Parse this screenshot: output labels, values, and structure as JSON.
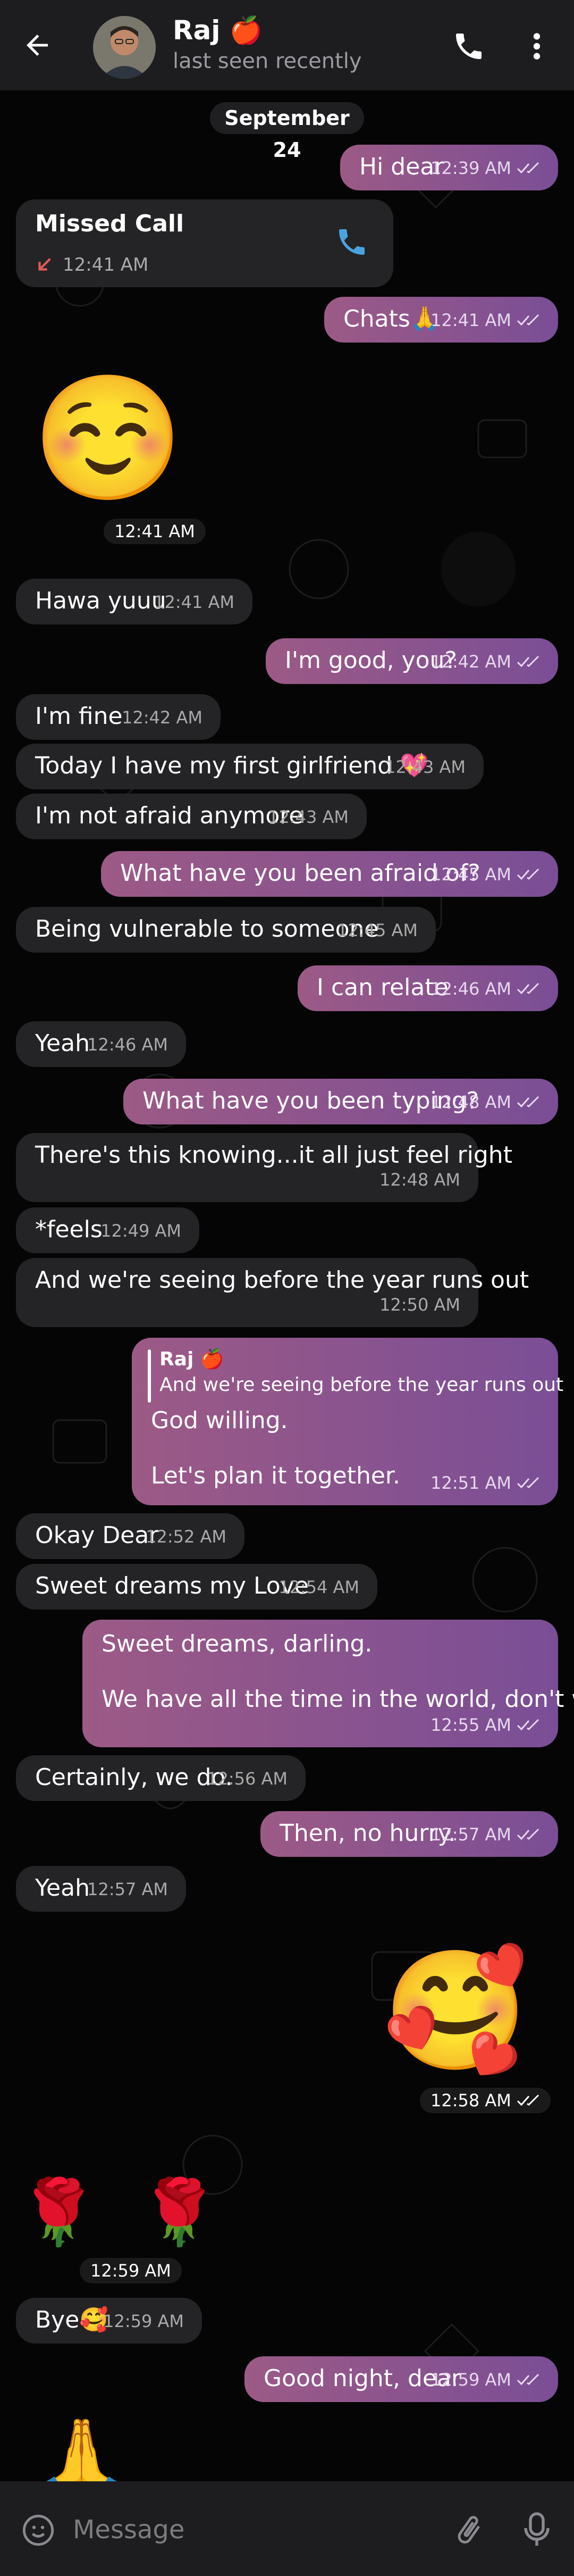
{
  "header": {
    "contact_name": "Raj 🍎",
    "status": "last seen recently"
  },
  "chat": {
    "date_label": "September 24",
    "messages": [
      {
        "dir": "out",
        "text": "Hi dear",
        "time": "12:39 AM"
      },
      {
        "dir": "in",
        "type": "call",
        "text": "Missed Call",
        "time": "12:41 AM"
      },
      {
        "dir": "out",
        "text": "Chats🙏",
        "time": "12:41 AM"
      },
      {
        "dir": "in",
        "type": "emoji",
        "text": "☺️",
        "time": "12:41 AM"
      },
      {
        "dir": "in",
        "text": "Hawa yuuu",
        "time": "12:41 AM"
      },
      {
        "dir": "out",
        "text": "I'm good, you?",
        "time": "12:42 AM"
      },
      {
        "dir": "in",
        "text": "I'm fine",
        "time": "12:42 AM"
      },
      {
        "dir": "in",
        "text": "Today I have my first girlfriend 💖",
        "time": "12:43 AM"
      },
      {
        "dir": "in",
        "text": "I'm not afraid anymore",
        "time": "12:43 AM"
      },
      {
        "dir": "out",
        "text": "What have you been afraid of?",
        "time": "12:45 AM"
      },
      {
        "dir": "in",
        "text": "Being vulnerable to someone",
        "time": "12:45 AM"
      },
      {
        "dir": "out",
        "text": "I can relate",
        "time": "12:46 AM"
      },
      {
        "dir": "in",
        "text": "Yeah",
        "time": "12:46 AM"
      },
      {
        "dir": "out",
        "text": "What have you been typing?",
        "time": "12:48 AM"
      },
      {
        "dir": "in",
        "text": "There's this knowing...it all just feel right",
        "time": "12:48 AM"
      },
      {
        "dir": "in",
        "text": "*feels",
        "time": "12:49 AM"
      },
      {
        "dir": "in",
        "text": "And we're seeing before the year runs out",
        "time": "12:50 AM"
      },
      {
        "dir": "out",
        "type": "reply",
        "reply_name": "Raj 🍎",
        "reply_text": "And we're seeing before the year runs out",
        "line1": "God willing.",
        "line2": "Let's plan it together.",
        "time": "12:51 AM"
      },
      {
        "dir": "in",
        "text": "Okay Dear",
        "time": "12:52 AM"
      },
      {
        "dir": "in",
        "text": "Sweet dreams my Love",
        "time": "12:54 AM"
      },
      {
        "dir": "out",
        "line1": "Sweet dreams, darling.",
        "line2": "We have all the time in the world, don't we?",
        "time": "12:55 AM"
      },
      {
        "dir": "in",
        "text": "Certainly, we do.",
        "time": "12:56 AM"
      },
      {
        "dir": "out",
        "text": "Then, no hurry.",
        "time": "12:57 AM"
      },
      {
        "dir": "in",
        "text": "Yeah",
        "time": "12:57 AM"
      },
      {
        "dir": "out",
        "type": "emoji",
        "text": "🥰",
        "time": "12:58 AM"
      },
      {
        "dir": "in",
        "type": "emoji",
        "text": "🌹 🌹",
        "time": "12:59 AM"
      },
      {
        "dir": "in",
        "text": "Bye🥰",
        "time": "12:59 AM"
      },
      {
        "dir": "out",
        "text": "Good night, dear",
        "time": "12:59 AM"
      },
      {
        "dir": "in",
        "type": "emoji",
        "text": "🙏",
        "time": ""
      }
    ]
  },
  "input": {
    "placeholder": "Message"
  },
  "colors": {
    "header_bg": "#1d1d1f",
    "incoming_bubble": "#242426",
    "outgoing_gradient_start": "#9c5a86",
    "outgoing_gradient_end": "#7a4e96",
    "call_icon": "#4aa3e0",
    "missed_arrow": "#e05a5a"
  }
}
